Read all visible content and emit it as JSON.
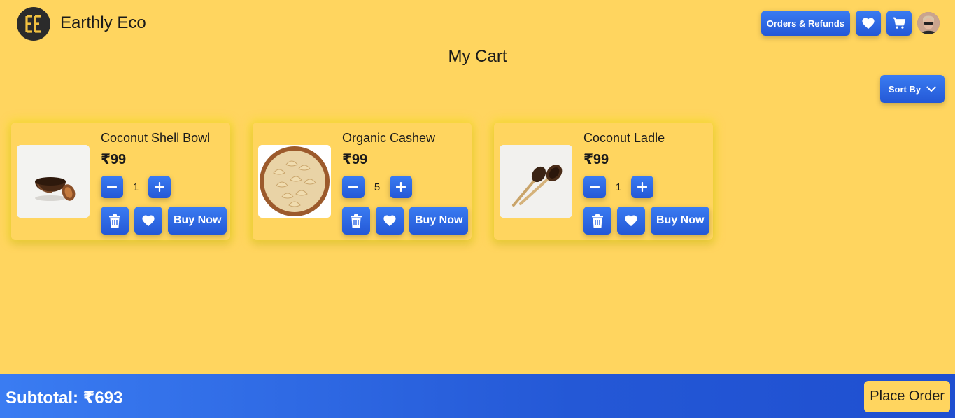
{
  "brand": {
    "name": "Earthly Eco",
    "logo_text": "EE"
  },
  "header": {
    "orders_label": "Orders & Refunds",
    "wishlist_icon": "heart-icon",
    "cart_icon": "cart-icon",
    "avatar": "user-avatar"
  },
  "page": {
    "title": "My Cart"
  },
  "sort": {
    "label": "Sort By",
    "icon": "chevron-down-icon"
  },
  "cart": {
    "items": [
      {
        "name": "Coconut Shell Bowl",
        "price": "₹99",
        "quantity": "1",
        "image": "coconut-bowl",
        "buy_label": "Buy Now"
      },
      {
        "name": "Organic Cashew",
        "price": "₹99",
        "quantity": "5",
        "image": "cashew-bowl",
        "buy_label": "Buy Now"
      },
      {
        "name": "Coconut Ladle",
        "price": "₹99",
        "quantity": "1",
        "image": "coconut-ladle",
        "buy_label": "Buy Now"
      }
    ]
  },
  "footer": {
    "subtotal": "Subtotal: ₹693",
    "place_order_label": "Place Order"
  },
  "colors": {
    "background": "#ffd55f",
    "accent": "#2f6ae6",
    "text": "#1a1a1a"
  }
}
